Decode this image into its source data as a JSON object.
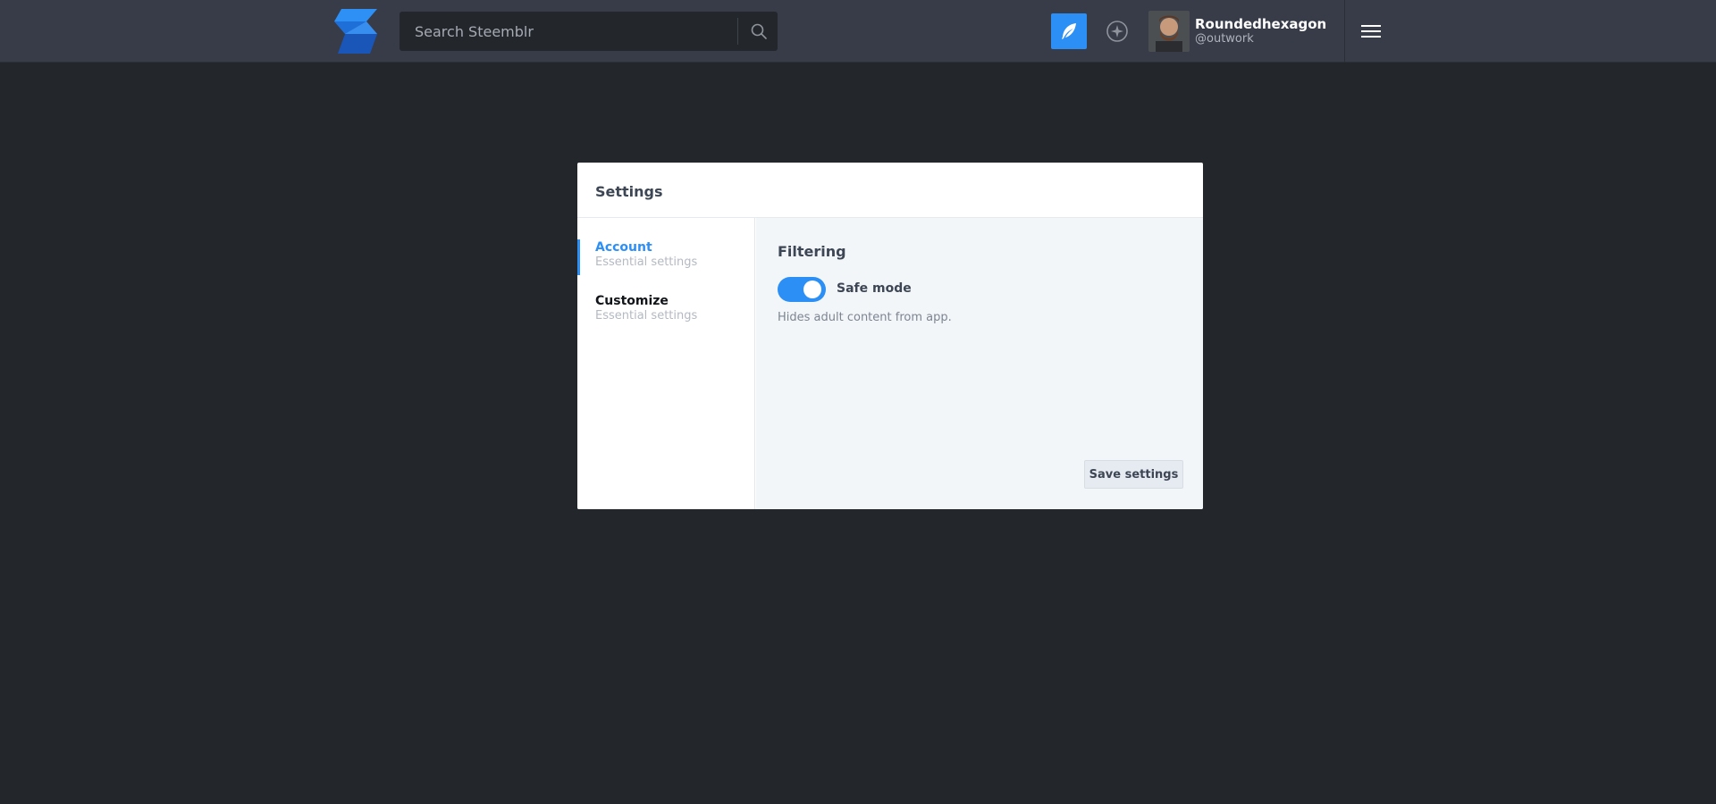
{
  "topbar": {
    "search_placeholder": "Search Steemblr",
    "user": {
      "name": "Roundedhexagon",
      "handle": "@outwork"
    }
  },
  "settings": {
    "title": "Settings",
    "nav": [
      {
        "label": "Account",
        "sub": "Essential settings",
        "active": true
      },
      {
        "label": "Customize",
        "sub": "Essential settings",
        "active": false
      }
    ],
    "section_title": "Filtering",
    "safe_mode": {
      "label": "Safe mode",
      "enabled": true,
      "help": "Hides adult content from app."
    },
    "save_label": "Save settings"
  },
  "colors": {
    "accent": "#2c8ff5",
    "topbar": "#373c48",
    "background": "#23262b"
  },
  "icons": [
    "steemblr-logo-icon",
    "search-icon",
    "feather-icon",
    "compass-icon",
    "hamburger-menu-icon"
  ]
}
